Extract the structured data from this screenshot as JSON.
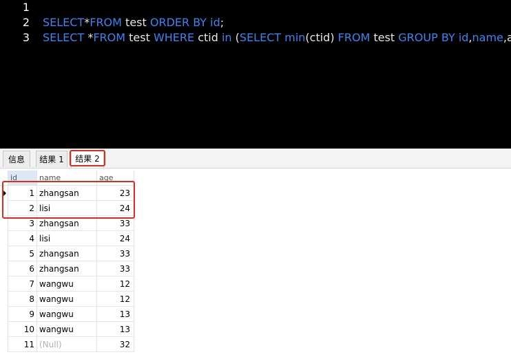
{
  "editor": {
    "lines": [
      {
        "no": "1",
        "tokens": []
      },
      {
        "no": "2",
        "tokens": [
          {
            "t": "SELECT",
            "k": "kw"
          },
          {
            "t": "*",
            "k": "tx"
          },
          {
            "t": "FROM",
            "k": "kw"
          },
          {
            "t": " test ",
            "k": "tx"
          },
          {
            "t": "ORDER BY",
            "k": "kw"
          },
          {
            "t": " ",
            "k": "tx"
          },
          {
            "t": "id",
            "k": "kw"
          },
          {
            "t": ";",
            "k": "tx"
          }
        ]
      },
      {
        "no": "3",
        "tokens": [
          {
            "t": "SELECT",
            "k": "kw"
          },
          {
            "t": " *",
            "k": "tx"
          },
          {
            "t": "FROM",
            "k": "kw"
          },
          {
            "t": " test ",
            "k": "tx"
          },
          {
            "t": "WHERE",
            "k": "kw"
          },
          {
            "t": " ctid ",
            "k": "tx"
          },
          {
            "t": "in",
            "k": "kw"
          },
          {
            "t": " (",
            "k": "tx"
          },
          {
            "t": "SELECT",
            "k": "kw"
          },
          {
            "t": " ",
            "k": "tx"
          },
          {
            "t": "min",
            "k": "kw"
          },
          {
            "t": "(ctid) ",
            "k": "tx"
          },
          {
            "t": "FROM",
            "k": "kw"
          },
          {
            "t": " test ",
            "k": "tx"
          },
          {
            "t": "GROUP BY",
            "k": "kw"
          },
          {
            "t": " ",
            "k": "tx"
          },
          {
            "t": "id",
            "k": "kw"
          },
          {
            "t": ",",
            "k": "tx"
          },
          {
            "t": "name",
            "k": "kw"
          },
          {
            "t": ",",
            "k": "tx"
          },
          {
            "t": "age",
            "k": "tx"
          },
          {
            "t": ")",
            "k": "tx"
          },
          {
            "t": "|cursor|",
            "k": "cursor"
          },
          {
            "t": ";",
            "k": "tx"
          }
        ]
      }
    ]
  },
  "tabs": {
    "info": "信息",
    "result1": "结果 1",
    "result2": "结果 2",
    "active": "result2"
  },
  "grid": {
    "columns": [
      "id",
      "name",
      "age"
    ],
    "rows": [
      {
        "id": "1",
        "name": "zhangsan",
        "age": "23",
        "current": true
      },
      {
        "id": "2",
        "name": "lisi",
        "age": "24"
      },
      {
        "id": "3",
        "name": "zhangsan",
        "age": "33"
      },
      {
        "id": "4",
        "name": "lisi",
        "age": "24"
      },
      {
        "id": "5",
        "name": "zhangsan",
        "age": "33"
      },
      {
        "id": "6",
        "name": "zhangsan",
        "age": "33"
      },
      {
        "id": "7",
        "name": "wangwu",
        "age": "12"
      },
      {
        "id": "8",
        "name": "wangwu",
        "age": "12"
      },
      {
        "id": "9",
        "name": "wangwu",
        "age": "13"
      },
      {
        "id": "10",
        "name": "wangwu",
        "age": "13"
      },
      {
        "id": "11",
        "name": "(Null)",
        "age": "32",
        "null_name": true
      }
    ]
  },
  "colors": {
    "editor_bg": "#000000",
    "keyword": "#3f83f1",
    "highlight_box": "#e1281e"
  }
}
